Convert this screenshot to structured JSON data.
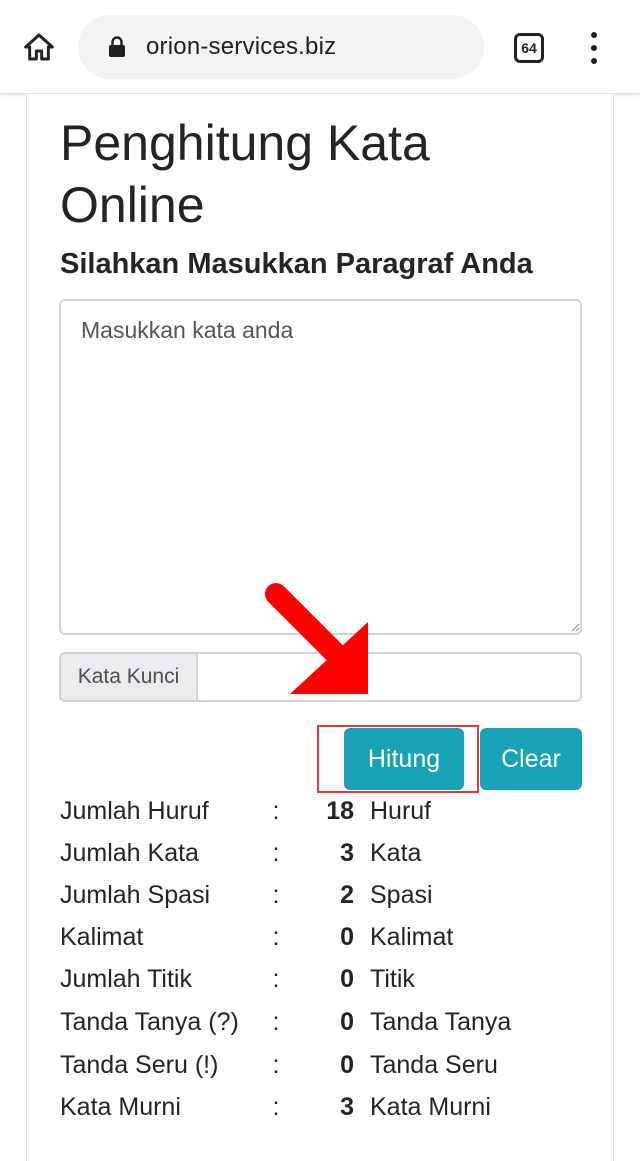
{
  "browser": {
    "url": "orion-services.biz",
    "tab_count": "64",
    "icons": {
      "home": "home-icon",
      "lock": "lock-icon",
      "tabs": "tab-switcher-icon",
      "menu": "more-vert-icon"
    }
  },
  "page": {
    "title": "Penghitung Kata Online",
    "subtitle": "Silahkan Masukkan Paragraf Anda",
    "textarea_placeholder": "Masukkan kata anda",
    "textarea_value": "",
    "keyword_label": "Kata Kunci",
    "keyword_value": "",
    "buttons": {
      "hitung": "Hitung",
      "clear": "Clear"
    },
    "colors": {
      "button": "#17a2b8",
      "annotation": "#e53935"
    }
  },
  "results": [
    {
      "label": "Jumlah Huruf",
      "sep": ":",
      "value": "18",
      "unit": "Huruf"
    },
    {
      "label": "Jumlah Kata",
      "sep": ":",
      "value": "3",
      "unit": "Kata"
    },
    {
      "label": "Jumlah Spasi",
      "sep": ":",
      "value": "2",
      "unit": "Spasi"
    },
    {
      "label": "Kalimat",
      "sep": ":",
      "value": "0",
      "unit": "Kalimat"
    },
    {
      "label": "Jumlah Titik",
      "sep": ":",
      "value": "0",
      "unit": "Titik"
    },
    {
      "label": "Tanda Tanya (?)",
      "sep": ":",
      "value": "0",
      "unit": "Tanda Tanya"
    },
    {
      "label": "Tanda Seru (!)",
      "sep": ":",
      "value": "0",
      "unit": "Tanda Seru"
    },
    {
      "label": "Kata Murni",
      "sep": ":",
      "value": "3",
      "unit": "Kata Murni"
    }
  ]
}
